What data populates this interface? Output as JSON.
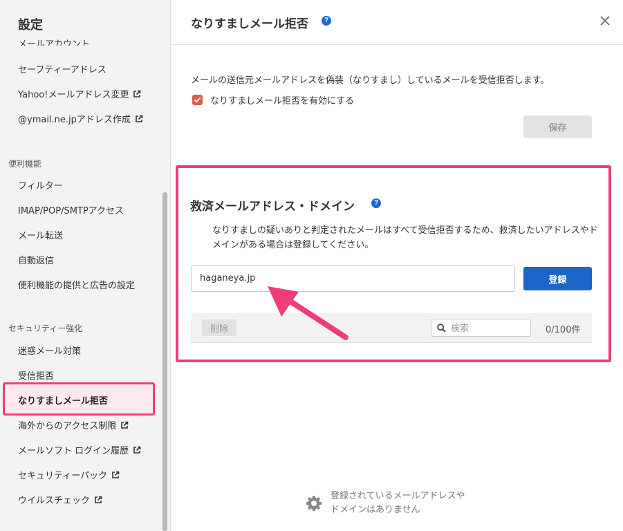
{
  "sidebar": {
    "title": "設定",
    "cut_item": "メールアカウント",
    "items_top": [
      {
        "label": "セーフティーアドレス",
        "external": false
      },
      {
        "label": "Yahoo!メールアドレス変更",
        "external": true
      },
      {
        "label": "@ymail.ne.jpアドレス作成",
        "external": true
      }
    ],
    "section_convenience": "便利機能",
    "items_convenience": [
      {
        "label": "フィルター"
      },
      {
        "label": "IMAP/POP/SMTPアクセス"
      },
      {
        "label": "メール転送"
      },
      {
        "label": "自動返信"
      },
      {
        "label": "便利機能の提供と広告の設定"
      }
    ],
    "section_security": "セキュリティー強化",
    "items_security": [
      {
        "label": "迷惑メール対策",
        "external": false
      },
      {
        "label": "受信拒否",
        "external": false
      },
      {
        "label": "なりすましメール拒否",
        "active": true
      },
      {
        "label": "海外からのアクセス制限",
        "external": true
      },
      {
        "label": "メールソフト ログイン履歴",
        "external": true
      },
      {
        "label": "セキュリティーパック",
        "external": true
      },
      {
        "label": "ウイルスチェック",
        "external": true
      }
    ]
  },
  "header": {
    "title": "なりすましメール拒否",
    "help_icon": "question-circle-icon",
    "close_icon": "close-x-icon"
  },
  "main": {
    "description": "メールの送信元メールアドレスを偽装（なりすまし）しているメールを受信拒否します。",
    "checkbox_label": "なりすましメール拒否を有効にする",
    "checkbox_checked": true,
    "save_label": "保存"
  },
  "rescue": {
    "title": "救済メールアドレス・ドメイン",
    "description": "なりすましの疑いありと判定されたメールはすべて受信拒否するため、救済したいアドレスやドメインがある場合は登録してください。",
    "input_value": "haganeya.jp",
    "register_label": "登録",
    "delete_label": "削除",
    "search_placeholder": "検索",
    "count": "0/100件",
    "empty_message": "登録されているメールアドレスや\nドメインはありません",
    "empty_icon": "gear-icon"
  },
  "colors": {
    "highlight": "#ef3d78",
    "primary_button": "#1a66c9",
    "checkbox": "#e05a4d",
    "help_icon": "#1c66d6"
  }
}
